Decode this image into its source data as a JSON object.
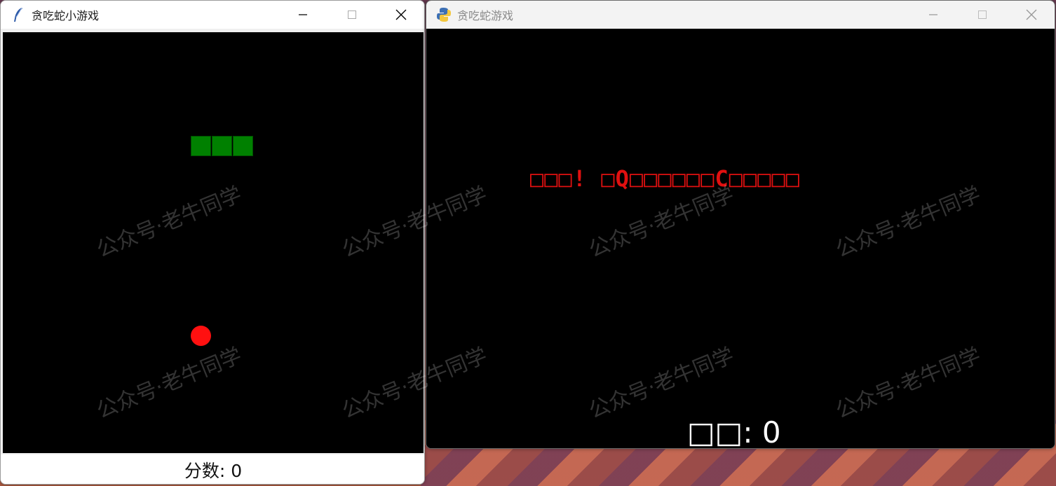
{
  "window_tk": {
    "title": "贪吃蛇小游戏",
    "icon": "feather-icon",
    "score_label": "分数: 0",
    "canvas_bg": "#000000",
    "snake_color": "#008000",
    "food_color": "#ff1010"
  },
  "window_pygame": {
    "title": "贪吃蛇游戏",
    "icon": "python-icon",
    "game_over_text": "□□□! □Q□□□□□□C□□□□□",
    "score_text": "□□: 0",
    "game_over_color": "#e01010"
  },
  "watermark": {
    "text": "公众号·老牛同学"
  },
  "controls": {
    "minimize_icon": "minimize-icon",
    "maximize_icon": "maximize-icon",
    "close_icon": "close-icon"
  }
}
